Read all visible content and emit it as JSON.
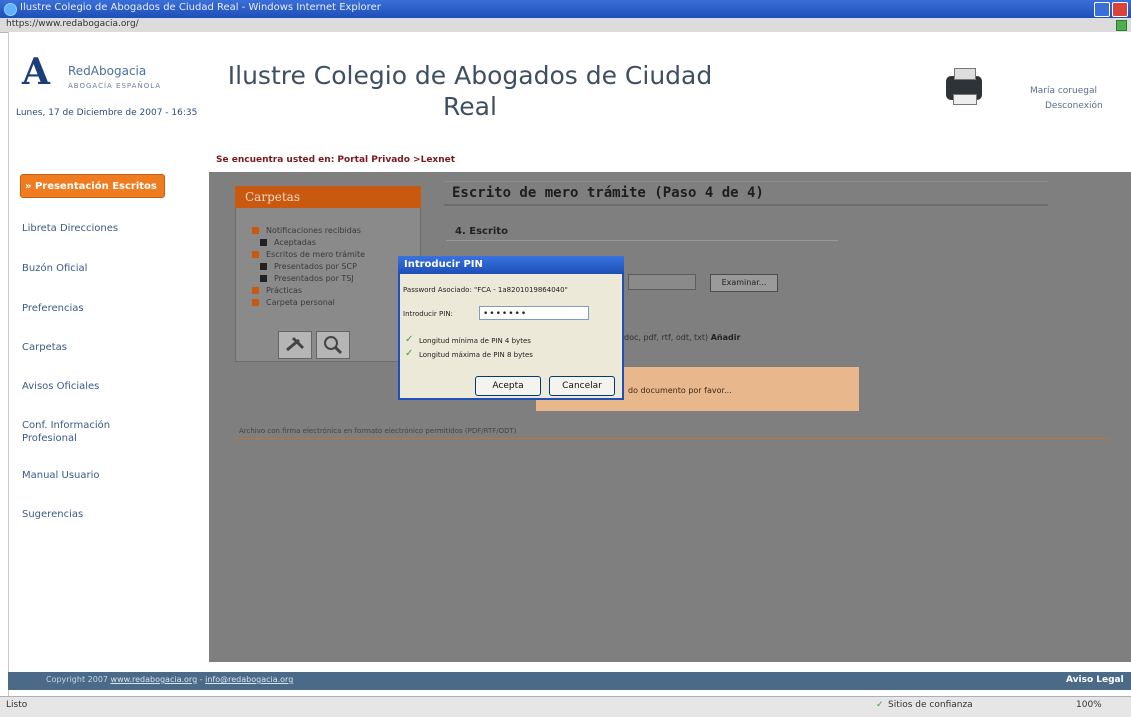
{
  "window": {
    "title": "Ilustre Colegio de Abogados de Ciudad Real - Windows Internet Explorer",
    "address": "https://www.redabogacia.org/"
  },
  "header": {
    "logo_name": "RedAbogacia",
    "logo_sub": "ABOGACÍA ESPAÑOLA",
    "date": "Lunes, 17 de Diciembre de 2007 - 16:35",
    "site_title": "Ilustre Colegio de Abogados de Ciudad Real",
    "user_line1": "María coruegal",
    "user_line2": "Desconexión"
  },
  "breadcrumb": "Se encuentra usted en: Portal Privado >Lexnet",
  "sidebar": {
    "active": "» Presentación Escritos",
    "items": [
      "Libreta Direcciones",
      "Buzón Oficial",
      "Preferencias",
      "Carpetas",
      "Avisos Oficiales",
      "Conf. Información Profesional",
      "Manual Usuario",
      "Sugerencias"
    ]
  },
  "carpetas": {
    "title": "Carpetas",
    "items": [
      "Notificaciones recibidas",
      "Aceptadas",
      "Escritos de mero trámite",
      "Presentados por SCP",
      "Presentados por TSJ",
      "Prácticas",
      "Carpeta personal"
    ]
  },
  "main": {
    "step_title": "Escrito de mero trámite (Paso 4 de 4)",
    "subsection": "4. Escrito",
    "browse_button": "Examinar...",
    "ext_text_prefix": "doc, pdf, rtf, odt, txt)",
    "ext_text_bold": "Añadir",
    "wait_text": "do documento por favor...",
    "note": "Archivo con firma electrónica en formato electrónico permitidos (PDF/RTF/ODT)"
  },
  "dialog": {
    "title": "Introducir PIN",
    "cert_line": "Password Asociado: \"FCA - 1a8201019864040\"",
    "pin_label": "Introducir PIN:",
    "pin_value": "•••••••",
    "rule1": "Longitud mínima de PIN 4 bytes",
    "rule2": "Longitud máxima de PIN 8 bytes",
    "accept": "Acepta",
    "cancel": "Cancelar"
  },
  "footer": {
    "copyright": "Copyright 2007",
    "link1": "www.redabogacia.org",
    "link2": "info@redabogacia.org",
    "legal": "Aviso Legal"
  },
  "statusbar": {
    "left": "Listo",
    "zone": "Sitios de confianza",
    "zoom": "100%"
  },
  "colors": {
    "accent_orange": "#f07c22",
    "overlay_gray": "#7f7f7f",
    "dialog_title_blue": "#1f4fb8"
  }
}
